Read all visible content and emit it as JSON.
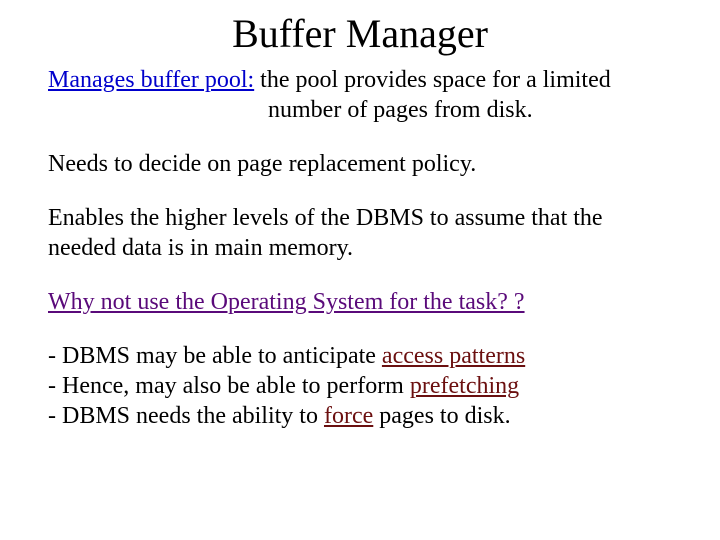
{
  "title": "Buffer Manager",
  "p1": {
    "lead": "Manages buffer pool:",
    "rest_line1": "  the pool provides space for a limited",
    "rest_line2": "number of pages from disk."
  },
  "p2": "Needs to decide on page replacement policy.",
  "p3": "Enables the higher levels of the DBMS to assume that the needed data is in main memory.",
  "p4": "Why not use the Operating System for the task? ?",
  "b1": {
    "pre": "- DBMS may be able to anticipate ",
    "link": "access patterns"
  },
  "b2": {
    "pre": "- Hence, may also be able to perform ",
    "link": "prefetching"
  },
  "b3": {
    "pre": "- DBMS needs the ability to ",
    "link": "force",
    "post": " pages to disk."
  }
}
